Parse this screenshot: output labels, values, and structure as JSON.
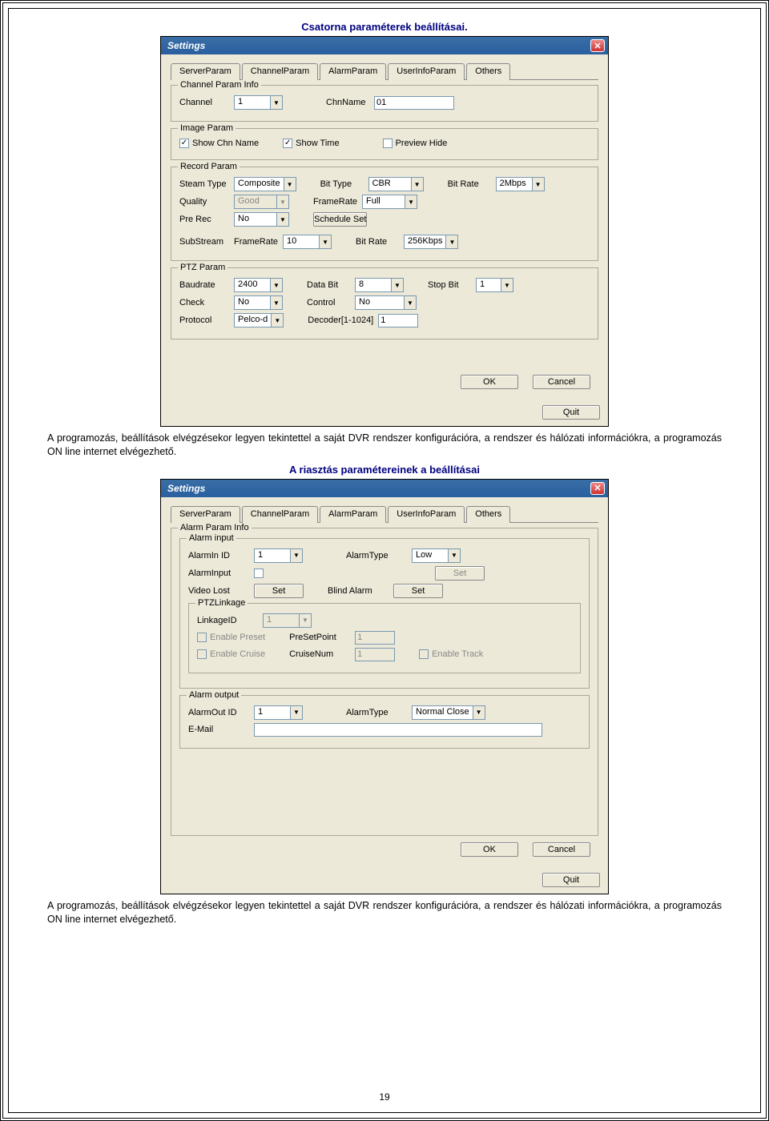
{
  "doc": {
    "title1": "Csatorna paraméterek beállításai.",
    "para1": "A programozás, beállítások elvégzésekor legyen tekintettel a saját DVR rendszer konfigurációra, a rendszer és hálózati információkra, a programozás ON line internet elvégezhető.",
    "title2": "A riasztás paramétereinek a beállításai",
    "para2": "A programozás, beállítások elvégzésekor legyen tekintettel a saját DVR rendszer konfigurációra, a rendszer és hálózati információkra, a programozás ON line internet elvégezhető.",
    "page_number": "19"
  },
  "dlg1": {
    "title": "Settings",
    "tabs": [
      "ServerParam",
      "ChannelParam",
      "AlarmParam",
      "UserInfoParam",
      "Others"
    ],
    "active_tab": 1,
    "channel_info": {
      "legend": "Channel Param Info",
      "channel_lbl": "Channel",
      "channel_val": "1",
      "chnname_lbl": "ChnName",
      "chnname_val": "01"
    },
    "image_param": {
      "legend": "Image Param",
      "show_chn": "Show Chn Name",
      "show_time": "Show Time",
      "preview_hide": "Preview Hide"
    },
    "record": {
      "legend": "Record Param",
      "steam_type_lbl": "Steam Type",
      "steam_type": "Composite",
      "bit_type_lbl": "Bit Type",
      "bit_type": "CBR",
      "bit_rate_lbl": "Bit Rate",
      "bit_rate": "2Mbps",
      "quality_lbl": "Quality",
      "quality": "Good",
      "framerate_lbl": "FrameRate",
      "framerate": "Full",
      "pre_rec_lbl": "Pre Rec",
      "pre_rec": "No",
      "schedule_btn": "Schedule Set",
      "substream_lbl": "SubStream",
      "sub_fr_lbl": "FrameRate",
      "sub_fr": "10",
      "sub_br_lbl": "Bit Rate",
      "sub_br": "256Kbps"
    },
    "ptz": {
      "legend": "PTZ Param",
      "baud_lbl": "Baudrate",
      "baud": "2400",
      "data_lbl": "Data Bit",
      "data": "8",
      "stop_lbl": "Stop Bit",
      "stop": "1",
      "check_lbl": "Check",
      "check": "No",
      "control_lbl": "Control",
      "control": "No",
      "protocol_lbl": "Protocol",
      "protocol": "Pelco-d",
      "decoder_lbl": "Decoder[1-1024]",
      "decoder": "1"
    },
    "ok": "OK",
    "cancel": "Cancel",
    "quit": "Quit"
  },
  "dlg2": {
    "title": "Settings",
    "tabs": [
      "ServerParam",
      "ChannelParam",
      "AlarmParam",
      "UserInfoParam",
      "Others"
    ],
    "active_tab": 2,
    "alarm_info": {
      "legend": "Alarm Param Info"
    },
    "alarm_input": {
      "legend": "Alarm input",
      "alarmin_lbl": "AlarmIn ID",
      "alarmin": "1",
      "alarmtype_lbl": "AlarmType",
      "alarmtype": "Low",
      "alarminput_lbl": "AlarmInput",
      "set_btn": "Set",
      "video_lost_lbl": "Video Lost",
      "video_lost_btn": "Set",
      "blind_lbl": "Blind Alarm",
      "blind_btn": "Set"
    },
    "ptzlink": {
      "legend": "PTZLinkage",
      "linkage_lbl": "LinkageID",
      "linkage": "1",
      "enable_preset": "Enable Preset",
      "preset_lbl": "PreSetPoint",
      "preset": "1",
      "enable_cruise": "Enable Cruise",
      "cruise_lbl": "CruiseNum",
      "cruise": "1",
      "enable_track": "Enable Track"
    },
    "alarm_output": {
      "legend": "Alarm output",
      "alarmout_lbl": "AlarmOut ID",
      "alarmout": "1",
      "alarmtype_lbl": "AlarmType",
      "alarmtype": "Normal Close",
      "email_lbl": "E-Mail",
      "email": ""
    },
    "ok": "OK",
    "cancel": "Cancel",
    "quit": "Quit"
  }
}
